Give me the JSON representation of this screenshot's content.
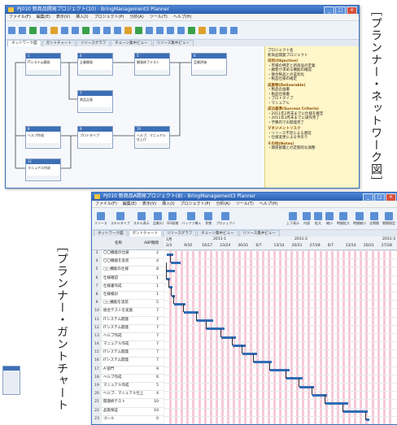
{
  "caption_top": "［プランナー・ネットワーク図］",
  "caption_left": "［プランナー・ガントチャート",
  "network_window": {
    "title": "PJ010 新商品開発プロジェクト(10) - BringManagement3 Planner",
    "menu": [
      "ファイル(F)",
      "編集(E)",
      "表示(V)",
      "挿入(I)",
      "プロジェクト(P)",
      "分析(A)",
      "ツール(T)",
      "ヘルプ(H)"
    ],
    "tabs": [
      "ネットワーク図",
      "ガントチャート",
      "リソースグラフ",
      "チェーン集中ビュー",
      "リソース集中ビュー"
    ],
    "nodes": [
      {
        "id": "1",
        "name": "ITシステム開発"
      },
      {
        "id": "4",
        "name": "企業開発"
      },
      {
        "id": "5",
        "name": "開発終了テスト"
      },
      {
        "id": "6",
        "name": "品質評価"
      },
      {
        "id": "7",
        "name": "商品企画"
      },
      {
        "id": "8",
        "name": "ヘルプ作成"
      },
      {
        "id": "9",
        "name": "プロトタイプ"
      },
      {
        "id": "10",
        "name": "ヘルプ、マニュアル仕上げ"
      },
      {
        "id": "11",
        "name": "マニュアル作成"
      }
    ],
    "panel": {
      "project_label": "プロジェクト名",
      "project_name": "新商品開発プロジェクト",
      "sections": [
        {
          "heading": "目的(Objective)",
          "lines": [
            "・市場の特定と新商品の定義",
            "・顧客が求める機能の確認",
            "・競合製品との差別化",
            "・製品仕様の確定"
          ]
        },
        {
          "heading": "成果物(Deliverable)",
          "lines": [
            "・製品企画書",
            "・製品仕様書",
            "・プロトタイプ",
            "・マニュアル"
          ]
        },
        {
          "heading": "成功基準(Success Criteria)",
          "lines": [
            "・2011年2月末までに仕様を確定",
            "・2011年3月末までに試作完了",
            "・予算内での開発完了"
          ]
        },
        {
          "heading": "マネジメントリスク",
          "lines": [
            "・リソース不足による遅延",
            "・仕様変更による手戻り"
          ]
        },
        {
          "heading": "その他(Notes)",
          "lines": [
            "・関係部署との定期的な調整"
          ]
        }
      ]
    }
  },
  "gantt_window": {
    "title": "PJ010 新商品A開発プロジェクト(8) - BringManagement3 Planner",
    "menu": [
      "ファイル(F)",
      "編集(E)",
      "表示(V)",
      "挿入(I)",
      "プロジェクト(P)",
      "分析(A)",
      "ツール(T)",
      "ヘルプ(H)"
    ],
    "toolbar_left": [
      "リソース",
      "スキルタイプ",
      "スキル表示",
      "品質(L)",
      "OG短縮",
      "バッファ挿入",
      "状態",
      "プロジェクト"
    ],
    "toolbar_right": [
      "上下表示",
      "内部",
      "拡大",
      "縮小",
      "時間拡大",
      "時間縮小",
      "全期間",
      "期間指定"
    ],
    "tabs": [
      "ネットワーク図",
      "ガントチャート",
      "リソースグラフ",
      "チェーン集中ビュー",
      "リソース集中ビュー"
    ],
    "col_name": "名称",
    "col_duration": "ABP期間",
    "months": [
      "1月",
      "2011-1",
      "2011-2",
      "2011-3"
    ],
    "days": [
      "2/3",
      "9/10",
      "16/17",
      "23/24",
      "30/31",
      "6/7",
      "13/14",
      "20/21",
      "27/28",
      "6/7",
      "13/14",
      "20/21",
      "27/28"
    ],
    "rows": [
      {
        "no": "3",
        "name": "〇〇機能の仕様",
        "dur": "2"
      },
      {
        "no": "4",
        "name": "〇〇機能を実装",
        "dur": "4"
      },
      {
        "no": "5",
        "name": "□□機能の仕様",
        "dur": "8"
      },
      {
        "no": "6",
        "name": "仕様確認",
        "dur": "1"
      },
      {
        "no": "7",
        "name": "仕様書作成",
        "dur": "1"
      },
      {
        "no": "8",
        "name": "仕様検討",
        "dur": "1"
      },
      {
        "no": "9",
        "name": "□□機能を実装",
        "dur": "5"
      },
      {
        "no": "10",
        "name": "統合テストを実施",
        "dur": "7"
      },
      {
        "no": "11",
        "name": "ITシステム開発",
        "dur": "7"
      },
      {
        "no": "12",
        "name": "ITシステム開発",
        "dur": "7"
      },
      {
        "no": "13",
        "name": "ヘルプ作成",
        "dur": "7"
      },
      {
        "no": "14",
        "name": "マニュアル作成",
        "dur": "7"
      },
      {
        "no": "15",
        "name": "ITシステム開発",
        "dur": "7"
      },
      {
        "no": "16",
        "name": "ITシステム開発",
        "dur": "7"
      },
      {
        "no": "17",
        "name": "A'部門",
        "dur": "9"
      },
      {
        "no": "18",
        "name": "ヘルプ作成",
        "dur": "6"
      },
      {
        "no": "19",
        "name": "マニュアル作成",
        "dur": "5"
      },
      {
        "no": "20",
        "name": "ヘルプ、マニュアル仕上",
        "dur": "4"
      },
      {
        "no": "21",
        "name": "開発終テスト",
        "dur": "10"
      },
      {
        "no": "22",
        "name": "品質保証",
        "dur": "10"
      },
      {
        "no": "23",
        "name": "ゴール",
        "dur": "0"
      }
    ]
  },
  "colors": {
    "titlebar": "#2a5fb0",
    "bar": "#2f6cb5",
    "holiday": "#f6c9d8",
    "panel": "#fff6c9"
  }
}
